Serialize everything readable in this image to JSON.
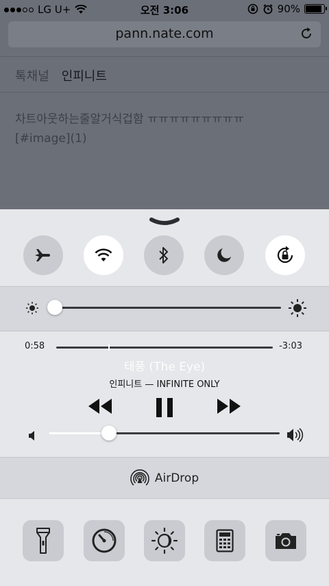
{
  "status_bar": {
    "carrier": "LG U+",
    "signal_bars_filled": 3,
    "signal_bars_total": 5,
    "time": "오전 3:06",
    "battery_percent": "90%",
    "battery_level": 0.9
  },
  "browser": {
    "url": "pann.nate.com",
    "breadcrumb": [
      "톡채널",
      "인피니트"
    ],
    "post_line1": "차트아웃하는줄알거식겁함 ㅠㅠㅠㅠㅠㅠㅠㅠㅠ",
    "post_line2": "[#image](1)"
  },
  "control_center": {
    "toggles": [
      {
        "name": "airplane-mode",
        "icon": "airplane-icon",
        "on": false
      },
      {
        "name": "wifi",
        "icon": "wifi-icon",
        "on": true
      },
      {
        "name": "bluetooth",
        "icon": "bluetooth-icon",
        "on": false
      },
      {
        "name": "do-not-disturb",
        "icon": "moon-icon",
        "on": false
      },
      {
        "name": "rotation-lock",
        "icon": "rotation-lock-icon",
        "on": true
      }
    ],
    "brightness_level": 0.0,
    "music": {
      "elapsed": "0:58",
      "remaining": "-3:03",
      "progress": 0.24,
      "song_title": "태풍 (The Eye)",
      "artist_album": "인피니트 — INFINITE ONLY",
      "volume_level": 0.26
    },
    "airdrop_label": "AirDrop",
    "shortcuts": [
      "flashlight-icon",
      "timer-icon",
      "night-shift-icon",
      "calculator-icon",
      "camera-icon"
    ],
    "colors": {
      "panel": "#e6e7ea",
      "band": "#d5d7dc",
      "toggle_off": "#c9cbd1",
      "toggle_on": "#ffffff"
    }
  }
}
